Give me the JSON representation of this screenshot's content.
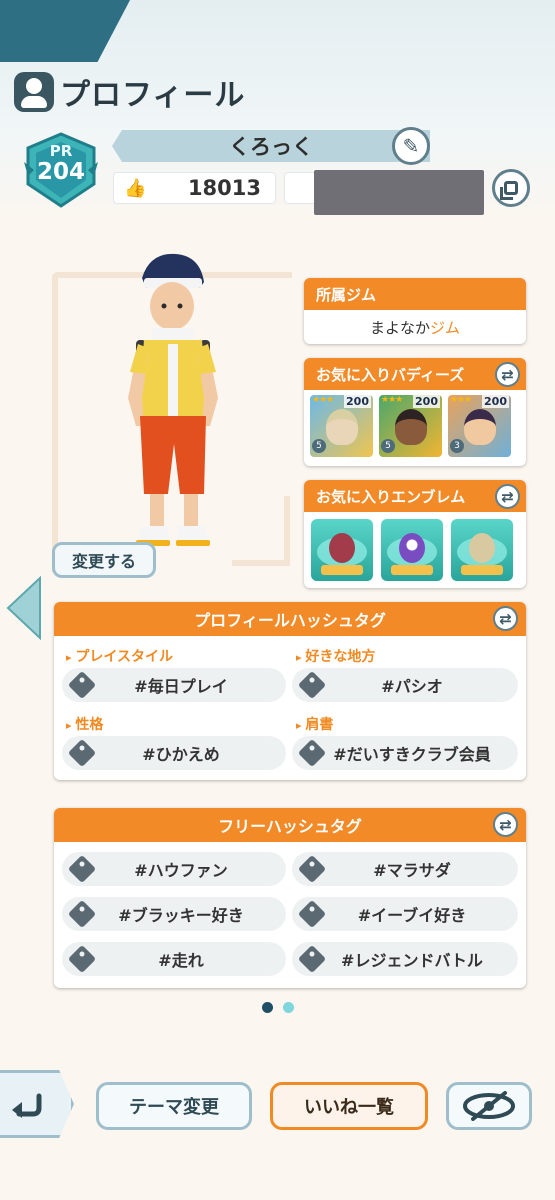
{
  "header": {
    "title": "プロフィール",
    "pr_label": "PR",
    "pr_value": "204",
    "trainer_name": "くろっく",
    "likes_count": "18013"
  },
  "character": {
    "change_label": "変更する"
  },
  "gym_card": {
    "title": "所属ジム",
    "name_prefix": "まよなか",
    "name_suffix": "ジム"
  },
  "buddies_card": {
    "title": "お気に入りバディーズ",
    "buddies": [
      {
        "level": "200",
        "stars": "★★★",
        "number": "5"
      },
      {
        "level": "200",
        "stars": "★★★",
        "number": "5"
      },
      {
        "level": "200",
        "stars": "★★★",
        "number": "3"
      }
    ]
  },
  "emblems_card": {
    "title": "お気に入りエンブレム"
  },
  "profile_tags": {
    "title": "プロフィールハッシュタグ",
    "fields": [
      {
        "label": "プレイスタイル",
        "value": "#毎日プレイ"
      },
      {
        "label": "好きな地方",
        "value": "#パシオ"
      },
      {
        "label": "性格",
        "value": "#ひかえめ"
      },
      {
        "label": "肩書",
        "value": "#だいすきクラブ会員"
      }
    ]
  },
  "free_tags": {
    "title": "フリーハッシュタグ",
    "tags": [
      "#ハウファン",
      "#マラサダ",
      "#ブラッキー好き",
      "#イーブイ好き",
      "#走れ",
      "#レジェンドバトル"
    ]
  },
  "bottom_bar": {
    "theme_label": "テーマ変更",
    "likes_list_label": "いいね一覧"
  },
  "colors": {
    "accent_orange": "#f28a28",
    "frame_blue": "#9fbecb",
    "header_teal": "#2f6f83"
  }
}
